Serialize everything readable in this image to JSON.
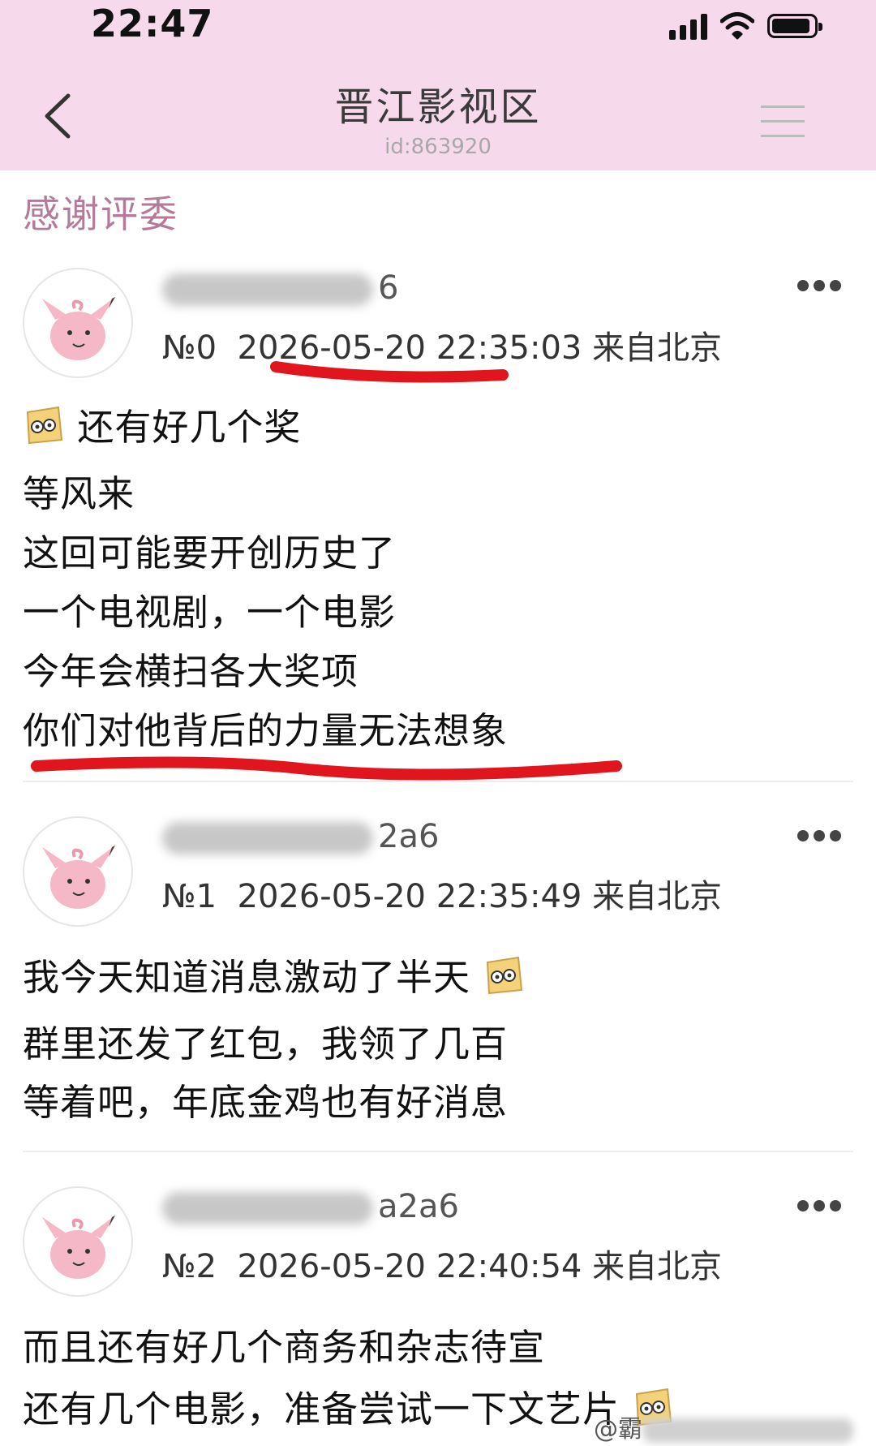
{
  "status_bar": {
    "time": "22:47"
  },
  "nav": {
    "title": "晋江影视区",
    "subtitle": "id:863920"
  },
  "section": {
    "title": "感谢评委"
  },
  "posts": [
    {
      "username_visible": "6",
      "floor": "№0",
      "date": "2026-05-20",
      "time": "22:35:03",
      "location": "来自北京",
      "lines": [
        "还有好几个奖",
        "等风来",
        "这回可能要开创历史了",
        "一个电视剧，一个电影",
        "今年会横扫各大奖项",
        "你们对他背后的力量无法想象"
      ]
    },
    {
      "username_visible": "2a6",
      "floor": "№1",
      "date": "2026-05-20",
      "time": "22:35:49",
      "location": "来自北京",
      "lines": [
        "我今天知道消息激动了半天",
        "群里还发了红包，我领了几百",
        "等着吧，年底金鸡也有好消息"
      ]
    },
    {
      "username_visible": "a2a6",
      "floor": "№2",
      "date": "2026-05-20",
      "time": "22:40:54",
      "location": "来自北京",
      "lines": [
        "而且还有好几个商务和杂志待宣",
        "还有几个电影，准备尝试一下文艺片"
      ]
    }
  ],
  "watermark": {
    "text": "@霸"
  },
  "colors": {
    "header_bg": "#f6d9ea",
    "section_title": "#b37a99",
    "annotation_red": "#e0151d"
  }
}
